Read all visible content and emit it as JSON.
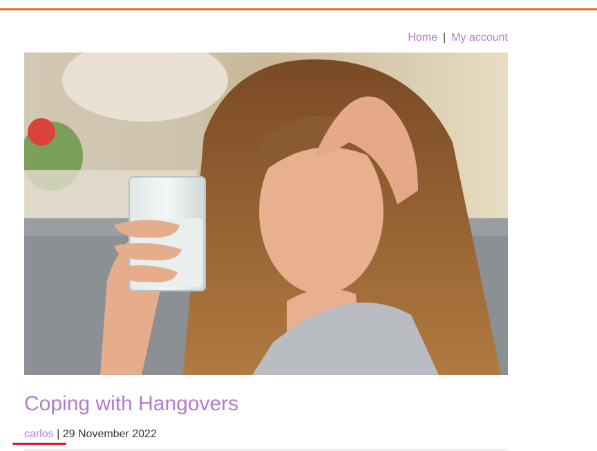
{
  "nav": {
    "home_label": "Home",
    "separator": "|",
    "account_label": "My account"
  },
  "post": {
    "title": "Coping with Hangovers",
    "author": "carlos",
    "meta_separator": "|",
    "date": "29 November 2022"
  },
  "colors": {
    "accent_bar": "#ee6633",
    "link": "#b57ad0",
    "annotation": "#dd1122"
  }
}
